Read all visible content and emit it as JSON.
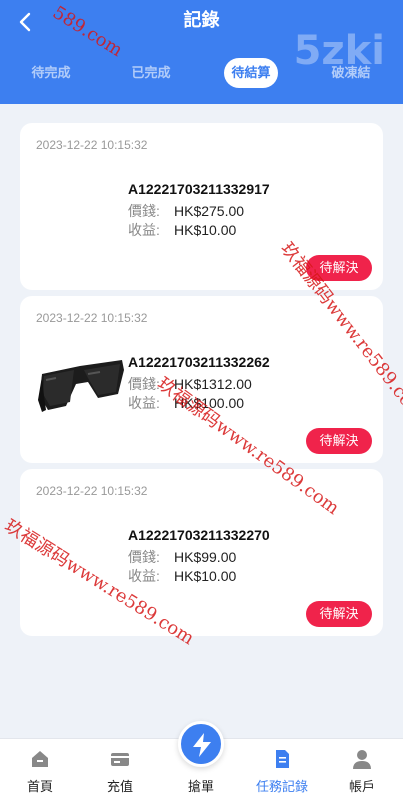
{
  "header": {
    "title": "記錄",
    "brand": "5zki",
    "tabs": [
      "待完成",
      "已完成",
      "待結算",
      "破凍結"
    ]
  },
  "orders": [
    {
      "time": "2023-12-22 10:15:32",
      "id": "A12221703211332917",
      "price_label": "價錢:",
      "price": "HK$275.00",
      "income_label": "收益:",
      "income": "HK$10.00",
      "status": "待解決",
      "image": ""
    },
    {
      "time": "2023-12-22 10:15:32",
      "id": "A12221703211332262",
      "price_label": "價錢:",
      "price": "HK$1312.00",
      "income_label": "收益:",
      "income": "HK$100.00",
      "status": "待解決",
      "image": "sunglasses"
    },
    {
      "time": "2023-12-22 10:15:32",
      "id": "A12221703211332270",
      "price_label": "價錢:",
      "price": "HK$99.00",
      "income_label": "收益:",
      "income": "HK$10.00",
      "status": "待解決",
      "image": ""
    }
  ],
  "tabbar": {
    "items": [
      {
        "label": "首頁",
        "icon": "home-icon"
      },
      {
        "label": "充值",
        "icon": "card-icon"
      },
      {
        "label": "搶單",
        "icon": "lightning-icon"
      },
      {
        "label": "任務記錄",
        "icon": "document-icon"
      },
      {
        "label": "帳戶",
        "icon": "user-icon"
      }
    ]
  },
  "watermarks": [
    "玖福源码www.re589.com",
    "玖福源码www.re589.com",
    "玖福源码www.re589.com",
    "589.com"
  ],
  "colors": {
    "primary": "#3d7ff0",
    "status": "#f0234b",
    "watermark": "#d61818"
  }
}
